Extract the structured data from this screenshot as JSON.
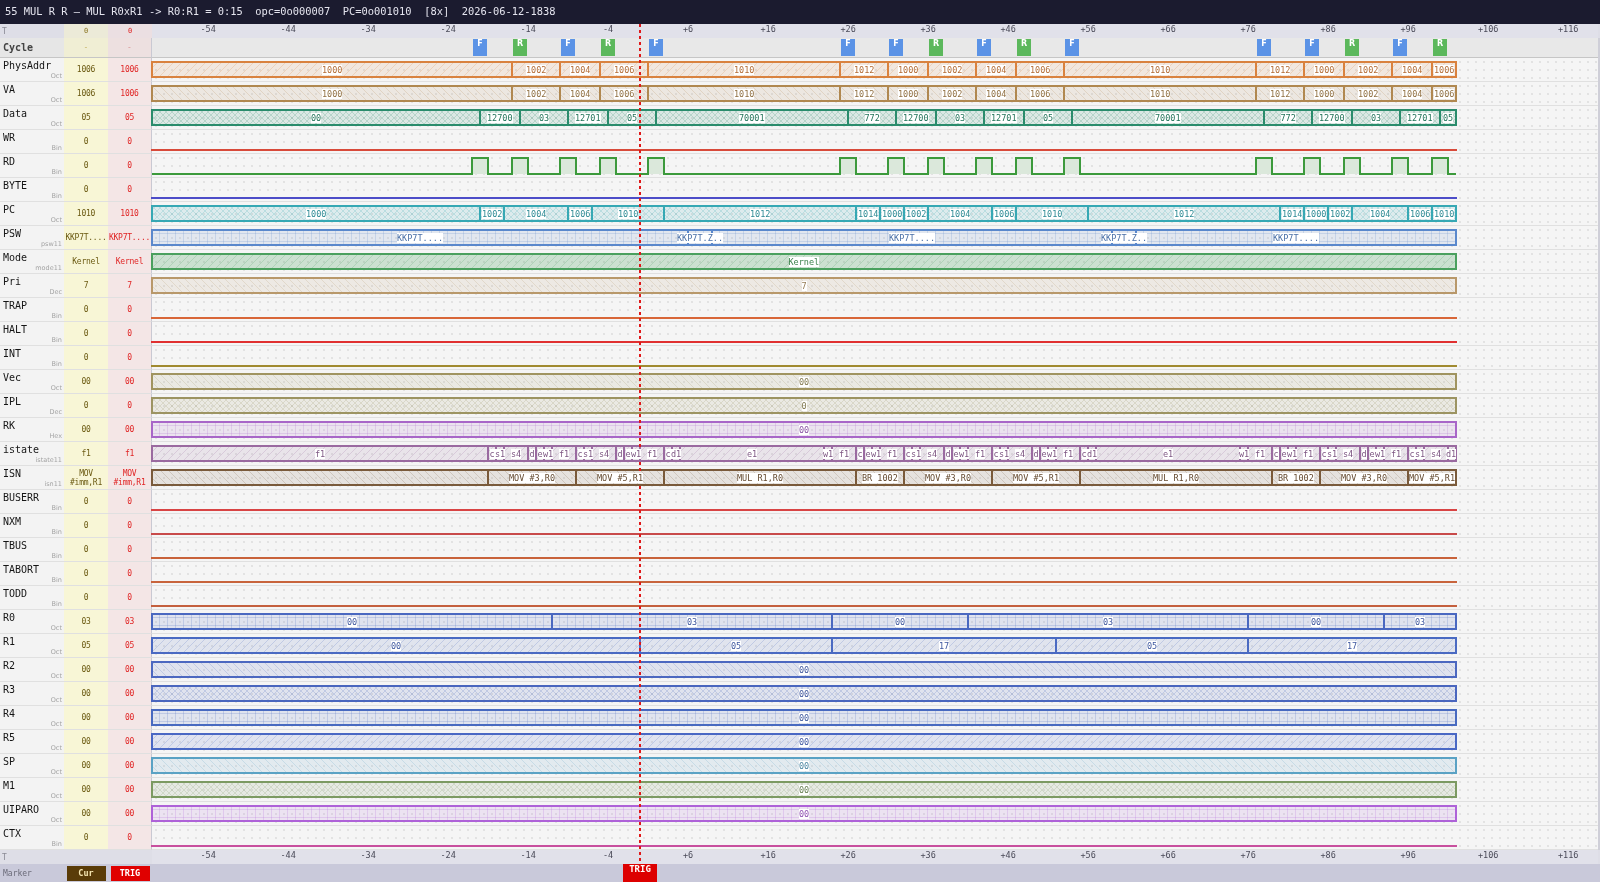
{
  "title": "55 MUL R R — MUL R0xR1 -> R0:R1 = 0:15  opc=0o000007  PC=0o001010  [8x]  2026-06-12-1838",
  "top_axis": {
    "label": "T",
    "cursor_value": "0",
    "trigger_value": "0",
    "ticks": [
      "-54",
      "-44",
      "-34",
      "-24",
      "-14",
      "-4",
      "+6",
      "+16",
      "+26",
      "+36",
      "+46",
      "+56",
      "+66",
      "+76",
      "+86",
      "+96",
      "+106",
      "+116"
    ]
  },
  "cycle": {
    "name": "Cycle",
    "cursor_value": "-",
    "trigger_value": "-",
    "markers": [
      {
        "label": "F",
        "color": "#5b93e6"
      },
      {
        "label": "R",
        "color": "#5cb85c"
      },
      {
        "label": "F",
        "color": "#5b93e6"
      },
      {
        "label": "R",
        "color": "#5cb85c"
      },
      {
        "label": "F",
        "color": "#5b93e6"
      },
      {
        "label": "F",
        "color": "#5b93e6"
      },
      {
        "label": "F",
        "color": "#5b93e6"
      },
      {
        "label": "R",
        "color": "#5cb85c"
      },
      {
        "label": "F",
        "color": "#5b93e6"
      },
      {
        "label": "R",
        "color": "#5cb85c"
      },
      {
        "label": "F",
        "color": "#5b93e6"
      },
      {
        "label": "F",
        "color": "#5b93e6"
      },
      {
        "label": "F",
        "color": "#5b93e6"
      },
      {
        "label": "R",
        "color": "#5cb85c"
      },
      {
        "label": "F",
        "color": "#5b93e6"
      },
      {
        "label": "R",
        "color": "#5cb85c"
      }
    ]
  },
  "signals": [
    {
      "name": "PhysAddr",
      "radix": "Oct",
      "cursor_value": "1006",
      "trigger_value": "1006",
      "kind": "bus",
      "color": "#d9823f",
      "segments": [
        "1000",
        "1002",
        "1004",
        "1006",
        "1010",
        "1012",
        "1000",
        "1002",
        "1004",
        "1006",
        "1010",
        "1012",
        "1000",
        "1002",
        "1004",
        "1006"
      ]
    },
    {
      "name": "VA",
      "radix": "Oct",
      "cursor_value": "1006",
      "trigger_value": "1006",
      "kind": "bus",
      "color": "#b08850",
      "segments": [
        "1000",
        "1002",
        "1004",
        "1006",
        "1010",
        "1012",
        "1000",
        "1002",
        "1004",
        "1006",
        "1010",
        "1012",
        "1000",
        "1002",
        "1004",
        "1006"
      ]
    },
    {
      "name": "Data",
      "radix": "Oct",
      "cursor_value": "05",
      "trigger_value": "05",
      "kind": "bus",
      "color": "#2a8c6c",
      "segments": [
        "00",
        "12700",
        "03",
        "12701",
        "05",
        "70001",
        "772",
        "12700",
        "03",
        "12701",
        "05",
        "70001",
        "772",
        "12700",
        "03",
        "12701",
        "05"
      ]
    },
    {
      "name": "WR",
      "radix": "Bin",
      "cursor_value": "0",
      "trigger_value": "0",
      "kind": "bit",
      "color": "#d84a3a"
    },
    {
      "name": "RD",
      "radix": "Bin",
      "cursor_value": "0",
      "trigger_value": "0",
      "kind": "bit",
      "color": "#3c9a3c"
    },
    {
      "name": "BYTE",
      "radix": "Bin",
      "cursor_value": "0",
      "trigger_value": "0",
      "kind": "bit",
      "color": "#4c4cc8"
    },
    {
      "name": "PC",
      "radix": "Oct",
      "cursor_value": "1010",
      "trigger_value": "1010",
      "kind": "bus",
      "color": "#36a8b4",
      "segments": [
        "1000",
        "1002",
        "1004",
        "1006",
        "1010",
        "1012",
        "1014",
        "1000",
        "1002",
        "1004",
        "1006",
        "1010",
        "1012",
        "1014",
        "1000",
        "1002",
        "1004",
        "1006",
        "1010"
      ]
    },
    {
      "name": "PSW",
      "radix": "psw11",
      "cursor_value": "KKP7T....",
      "trigger_value": "KKP7T....",
      "kind": "bus",
      "color": "#5a88cc",
      "segments": [
        "KKP7T....",
        "KKP7T.Z..",
        "KKP7T....",
        "KKP7T.Z..",
        "KKP7T...."
      ]
    },
    {
      "name": "Mode",
      "radix": "mode11",
      "cursor_value": "Kernel",
      "trigger_value": "Kernel",
      "kind": "bus",
      "color": "#4aa05e",
      "segments": [
        "Kernel"
      ]
    },
    {
      "name": "Pri",
      "radix": "Dec",
      "cursor_value": "7",
      "trigger_value": "7",
      "kind": "bus",
      "color": "#b8986a",
      "segments": [
        "7"
      ]
    },
    {
      "name": "TRAP",
      "radix": "Bin",
      "cursor_value": "0",
      "trigger_value": "0",
      "kind": "bit",
      "color": "#d86638"
    },
    {
      "name": "HALT",
      "radix": "Bin",
      "cursor_value": "0",
      "trigger_value": "0",
      "kind": "bit",
      "color": "#e03030"
    },
    {
      "name": "INT",
      "radix": "Bin",
      "cursor_value": "0",
      "trigger_value": "0",
      "kind": "bit",
      "color": "#a08a30"
    },
    {
      "name": "Vec",
      "radix": "Oct",
      "cursor_value": "00",
      "trigger_value": "00",
      "kind": "bus",
      "color": "#a09460",
      "segments": [
        "00"
      ]
    },
    {
      "name": "IPL",
      "radix": "Dec",
      "cursor_value": "0",
      "trigger_value": "0",
      "kind": "bus",
      "color": "#9c9462",
      "segments": [
        "0"
      ]
    },
    {
      "name": "RK",
      "radix": "Hex",
      "cursor_value": "00",
      "trigger_value": "00",
      "kind": "bus",
      "color": "#a866c8",
      "segments": [
        "00"
      ]
    },
    {
      "name": "istate",
      "radix": "istate11",
      "cursor_value": "f1",
      "trigger_value": "f1",
      "kind": "bus",
      "color": "#9a6aa0",
      "segments": [
        "f1",
        "c",
        "s1",
        "s4",
        "d",
        "e",
        "w1",
        "f1",
        "c",
        "s1",
        "s4",
        "d",
        "e",
        "w1",
        "f1",
        "c",
        "d1",
        "e1",
        "w1",
        "f1",
        "c",
        "e",
        "w1",
        "f1",
        "c",
        "s1",
        "s4",
        "d",
        "e",
        "w1",
        "f1",
        "c",
        "s1",
        "s4",
        "d",
        "e",
        "w1",
        "f1",
        "c",
        "d1",
        "e1",
        "w1",
        "f1",
        "c",
        "e",
        "w1",
        "f1",
        "c",
        "s1",
        "s4",
        "d",
        "e",
        "w1",
        "f1",
        "c",
        "s1",
        "s4",
        "d1"
      ]
    },
    {
      "name": "ISN",
      "radix": "isn11",
      "cursor_value": "MOV #imm,R1",
      "trigger_value": "MOV #imm,R1",
      "kind": "bus",
      "color": "#7a5a3a",
      "segments": [
        "MOV #3,R0",
        "MOV #5,R1",
        "MUL R1,R0",
        "BR 1002",
        "MOV #3,R0",
        "MOV #5,R1",
        "MUL R1,R0",
        "BR 1002",
        "MOV #3,R0",
        "MOV #5,R1"
      ]
    },
    {
      "name": "BUSERR",
      "radix": "Bin",
      "cursor_value": "0",
      "trigger_value": "0",
      "kind": "bit",
      "color": "#d84444"
    },
    {
      "name": "NXM",
      "radix": "Bin",
      "cursor_value": "0",
      "trigger_value": "0",
      "kind": "bit",
      "color": "#c84a4a"
    },
    {
      "name": "TBUS",
      "radix": "Bin",
      "cursor_value": "0",
      "trigger_value": "0",
      "kind": "bit",
      "color": "#c8623a"
    },
    {
      "name": "TABORT",
      "radix": "Bin",
      "cursor_value": "0",
      "trigger_value": "0",
      "kind": "bit",
      "color": "#c8643c"
    },
    {
      "name": "TODD",
      "radix": "Bin",
      "cursor_value": "0",
      "trigger_value": "0",
      "kind": "bit",
      "color": "#c4603e"
    },
    {
      "name": "R0",
      "radix": "Oct",
      "cursor_value": "03",
      "trigger_value": "03",
      "kind": "bus",
      "color": "#4a68c0",
      "segments": [
        "00",
        "03",
        "00",
        "03",
        "00",
        "03"
      ]
    },
    {
      "name": "R1",
      "radix": "Oct",
      "cursor_value": "05",
      "trigger_value": "05",
      "kind": "bus",
      "color": "#4a6ac2",
      "segments": [
        "00",
        "05",
        "17",
        "05",
        "17"
      ]
    },
    {
      "name": "R2",
      "radix": "Oct",
      "cursor_value": "00",
      "trigger_value": "00",
      "kind": "bus",
      "color": "#4c68c0",
      "segments": [
        "00"
      ]
    },
    {
      "name": "R3",
      "radix": "Oct",
      "cursor_value": "00",
      "trigger_value": "00",
      "kind": "bus",
      "color": "#4a66be",
      "segments": [
        "00"
      ]
    },
    {
      "name": "R4",
      "radix": "Oct",
      "cursor_value": "00",
      "trigger_value": "00",
      "kind": "bus",
      "color": "#486ac0",
      "segments": [
        "00"
      ]
    },
    {
      "name": "R5",
      "radix": "Oct",
      "cursor_value": "00",
      "trigger_value": "00",
      "kind": "bus",
      "color": "#4a68c4",
      "segments": [
        "00"
      ]
    },
    {
      "name": "SP",
      "radix": "Oct",
      "cursor_value": "00",
      "trigger_value": "00",
      "kind": "bus",
      "color": "#5aa2c4",
      "segments": [
        "00"
      ]
    },
    {
      "name": "M1",
      "radix": "Oct",
      "cursor_value": "00",
      "trigger_value": "00",
      "kind": "bus",
      "color": "#7c9a62",
      "segments": [
        "00"
      ]
    },
    {
      "name": "UIPARO",
      "radix": "Oct",
      "cursor_value": "00",
      "trigger_value": "00",
      "kind": "bus",
      "color": "#ae62d8",
      "segments": [
        "00"
      ]
    },
    {
      "name": "CTX",
      "radix": "Bin",
      "cursor_value": "0",
      "trigger_value": "0",
      "kind": "bit",
      "color": "#c8509e"
    }
  ],
  "bottom_axis": {
    "label": "T",
    "ticks": [
      "-54",
      "-44",
      "-34",
      "-24",
      "-14",
      "-4",
      "+6",
      "+16",
      "+26",
      "+36",
      "+46",
      "+56",
      "+66",
      "+76",
      "+86",
      "+96",
      "+106",
      "+116"
    ]
  },
  "marker_bar": {
    "label": "Marker",
    "cursor_button": "Cur",
    "trigger_button": "TRIG",
    "trigger_flag": "TRIG"
  }
}
